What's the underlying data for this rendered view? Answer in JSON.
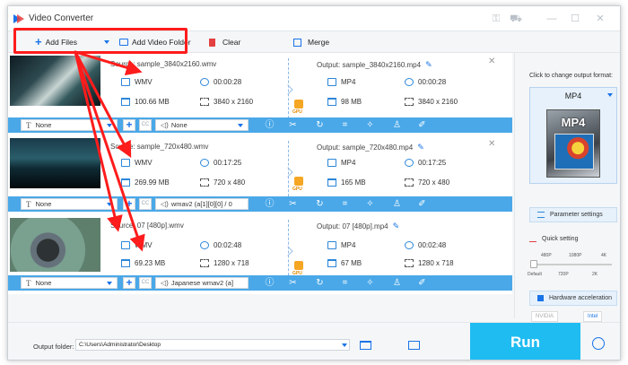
{
  "app": {
    "title": "Video Converter"
  },
  "toolbar": {
    "add_files": "Add Files",
    "add_video_folder": "Add Video Folder",
    "clear": "Clear",
    "merge": "Merge"
  },
  "items": [
    {
      "source": "Source: sample_3840x2160.wmv",
      "output": "Output: sample_3840x2160.mp4",
      "src_format": "WMV",
      "src_duration": "00:00:28",
      "src_size": "100.66 MB",
      "src_res": "3840 x 2160",
      "out_format": "MP4",
      "out_duration": "00:00:28",
      "out_size": "98 MB",
      "out_res": "3840 x 2160",
      "subtitle": "None",
      "audio": "None"
    },
    {
      "source": "Source: sample_720x480.wmv",
      "output": "Output: sample_720x480.mp4",
      "src_format": "WMV",
      "src_duration": "00:17:25",
      "src_size": "269.99 MB",
      "src_res": "720 x 480",
      "out_format": "MP4",
      "out_duration": "00:17:25",
      "out_size": "165 MB",
      "out_res": "720 x 480",
      "subtitle": "None",
      "audio": "wmav2 (a[1][0][0] / 0"
    },
    {
      "source": "Source: 07 [480p].wmv",
      "output": "Output: 07 [480p].mp4",
      "src_format": "WMV",
      "src_duration": "00:02:48",
      "src_size": "69.23 MB",
      "src_res": "1280 x 718",
      "out_format": "MP4",
      "out_duration": "00:02:48",
      "out_size": "67 MB",
      "out_res": "1280 x 718",
      "subtitle": "None",
      "audio": "Japanese wmav2 (a]"
    }
  ],
  "gpu_label": "GPU",
  "cc_label": "CC",
  "right_panel": {
    "click_to_change": "Click to change output format:",
    "format": "MP4",
    "format_art_label": "MP4",
    "parameter_settings": "Parameter settings",
    "quick_setting": "Quick setting",
    "quality_top": [
      "480P",
      "1080P",
      "4K"
    ],
    "quality_bottom": [
      "Default",
      "720P",
      "2K"
    ],
    "hardware_acceleration": "Hardware acceleration",
    "nvidia": "NVIDIA",
    "intel": "Intel"
  },
  "bottom": {
    "output_folder_label": "Output folder:",
    "output_folder_value": "C:\\Users\\Administrator\\Desktop",
    "run": "Run"
  },
  "colors": {
    "accent": "#1a73e8",
    "bar": "#4aa8e8",
    "run": "#1fbcf2",
    "annotation": "#ff1c1c"
  }
}
